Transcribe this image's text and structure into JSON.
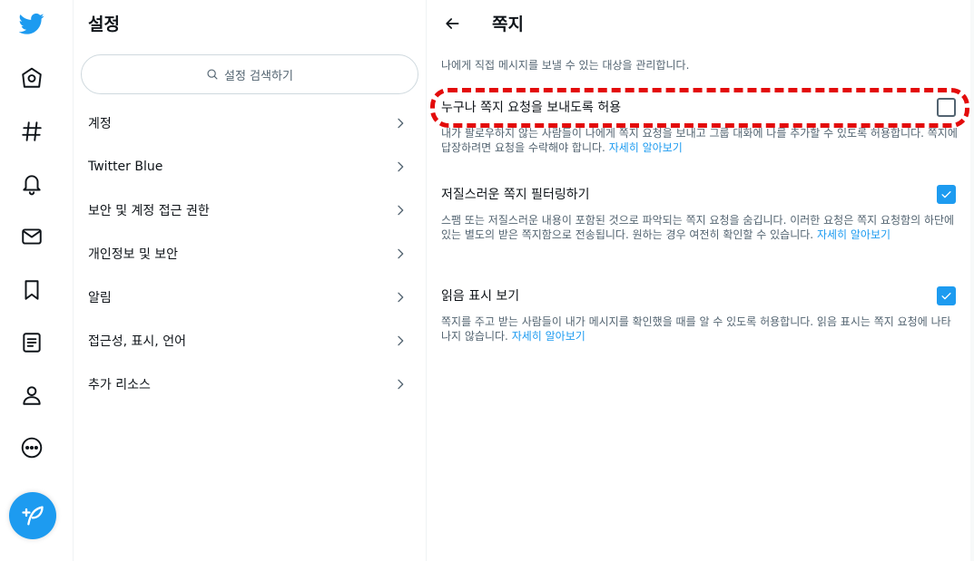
{
  "settings": {
    "title": "설정",
    "search_placeholder": "설정 검색하기",
    "items": [
      {
        "label": "계정"
      },
      {
        "label": "Twitter Blue"
      },
      {
        "label": "보안 및 계정 접근 권한"
      },
      {
        "label": "개인정보 및 보안"
      },
      {
        "label": "알림"
      },
      {
        "label": "접근성, 표시, 언어"
      },
      {
        "label": "추가 리소스"
      }
    ]
  },
  "detail": {
    "title": "쪽지",
    "intro": "나에게 직접 메시지를 보낼 수 있는 대상을 관리합니다.",
    "allow_requests": {
      "label": "누구나 쪽지 요청을 보내도록 허용",
      "desc": "내가 팔로우하지 않는 사람들이 나에게 쪽지 요청을 보내고 그룹 대화에 나를 추가할 수 있도록 허용합니다. 쪽지에 답장하려면 요청을 수락해야 합니다.",
      "link": "자세히 알아보기",
      "checked": false
    },
    "filter": {
      "label": "저질스러운 쪽지 필터링하기",
      "desc": "스팸 또는 저질스러운 내용이 포함된 것으로 파악되는 쪽지 요청을 숨깁니다. 이러한 요청은 쪽지 요청함의 하단에 있는 별도의 받은 쪽지함으로 전송됩니다. 원하는 경우 여전히 확인할 수 있습니다.",
      "link": "자세히 알아보기",
      "checked": true
    },
    "read_receipts": {
      "label": "읽음 표시 보기",
      "desc": "쪽지를 주고 받는 사람들이 내가 메시지를 확인했을 때를 알 수 있도록 허용합니다. 읽음 표시는 쪽지 요청에 나타나지 않습니다.",
      "link": "자세히 알아보기",
      "checked": true
    }
  },
  "icons": {
    "logo": "twitter-bird-icon",
    "home": "home-icon",
    "explore": "hashtag-icon",
    "notifications": "bell-icon",
    "messages": "envelope-icon",
    "bookmarks": "bookmark-icon",
    "lists": "list-icon",
    "profile": "person-icon",
    "more": "more-circle-icon",
    "compose": "compose-feather-icon",
    "back": "back-arrow-icon",
    "search": "search-icon",
    "chevron": "chevron-right-icon",
    "check": "check-icon"
  },
  "colors": {
    "accent": "#1d9bf0",
    "highlight": "#e30b0b"
  }
}
